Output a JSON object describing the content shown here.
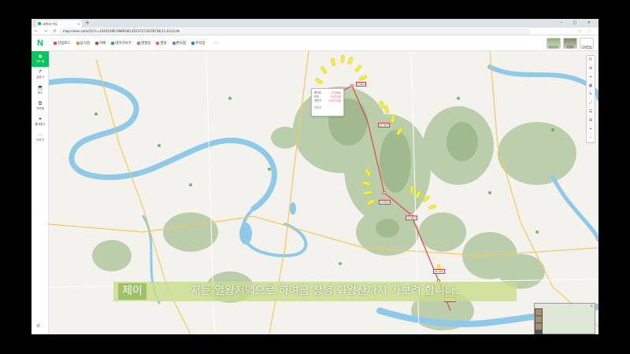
{
  "browser": {
    "tab_title": "네이버 지도",
    "tab_close": "×",
    "new_tab": "+",
    "window_controls": "– ▢ ×",
    "nav_buttons": "← → ⟳",
    "url": "map.naver.com/v5/?c=14431406.0989340,4223727.8378738,11,0,0,0,dh",
    "extensions": "☆ ⋮"
  },
  "header": {
    "logo": "N",
    "categories": [
      {
        "label": "산림로드",
        "color": "#e84b4b"
      },
      {
        "label": "음식점",
        "color": "#f08c2b"
      },
      {
        "label": "카페",
        "color": "#8b5a3c"
      },
      {
        "label": "테이크아웃",
        "color": "#33a852"
      },
      {
        "label": "명절장",
        "color": "#c06bd4"
      },
      {
        "label": "병원",
        "color": "#e8646b"
      },
      {
        "label": "편의점",
        "color": "#4b8be8"
      },
      {
        "label": "주차장",
        "color": "#2b7be8"
      },
      {
        "label": "···",
        "color": "#ffffff"
      }
    ],
    "layers": [
      "위성지도",
      "지형도",
      "지적편집"
    ]
  },
  "sidebar": {
    "items": [
      {
        "icon": "◉",
        "label": "지도 홈"
      },
      {
        "icon": "↱",
        "label": "길찾기"
      },
      {
        "icon": "⬒",
        "label": "버스"
      },
      {
        "icon": "⧉",
        "label": "지하철"
      },
      {
        "icon": "✦",
        "label": "즐겨찾기"
      },
      {
        "icon": "⋯",
        "label": "더보기"
      }
    ],
    "footer": "⚙"
  },
  "right_tools": [
    "⟳",
    "⊕",
    "⌖",
    "▦",
    "✎",
    "⤢",
    "☰",
    "⊞",
    "+",
    "−"
  ],
  "measure_popup": {
    "rows": [
      {
        "k": "총거리",
        "v": "27.9km"
      },
      {
        "k": "도보",
        "v": "7시간 0분"
      },
      {
        "k": "자전거",
        "v": "1시간 51분"
      }
    ],
    "delete": "지우기"
  },
  "distance_labels": [
    "0.0km",
    "3.6km",
    "11.3km",
    "14.5km",
    "17.8km",
    "21.1km",
    "25.4km"
  ],
  "minimap": {
    "title": "",
    "close": "×"
  },
  "subtitle": {
    "speaker": "제이",
    "text": "저는 열왕지맥으로 하여금 창녕 화왕산까지 가보려 합니다."
  },
  "colors": {
    "route": "#e8383d",
    "highlight": "#f2ee3a",
    "forest": "#9db88a",
    "water": "#8ec9ea",
    "naver_green": "#03c75a"
  }
}
